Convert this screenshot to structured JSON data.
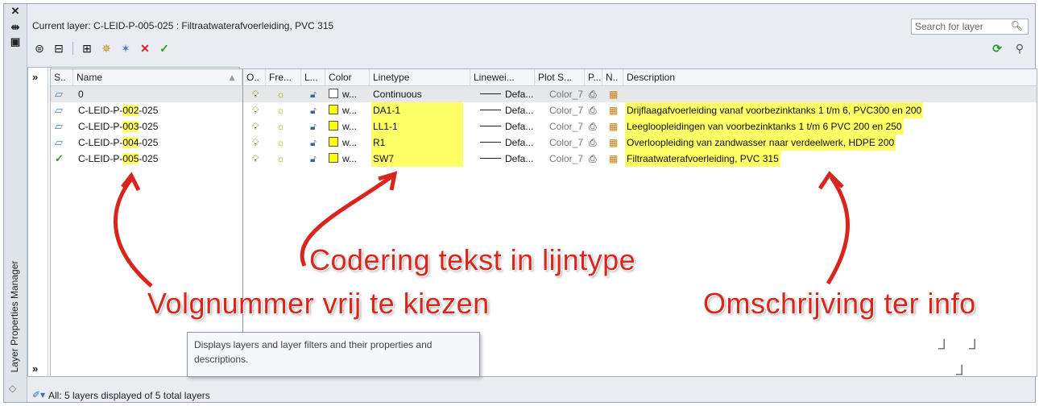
{
  "sidebar": {
    "close_icon": "close-icon",
    "autohide_icon": "autohide-icon",
    "properties_icon": "properties-icon",
    "title": "Layer Properties Manager"
  },
  "header": {
    "current_layer": "Current layer: C-LEID-P-005-025 : Filtraatwaterafvoerleiding, PVC 315",
    "search_placeholder": "Search for layer"
  },
  "toolbar": {
    "icons": [
      "new-property-filter-icon",
      "new-group-filter-icon",
      "layer-states-manager-icon",
      "new-layer-icon",
      "new-layer-vp-frozen-icon",
      "delete-layer-icon",
      "set-current-icon"
    ],
    "right_icons": [
      "refresh-icon",
      "settings-icon"
    ]
  },
  "tree": {
    "expand_label": "»",
    "collapse_label": "»"
  },
  "columns": [
    "S..",
    "Name",
    "O..",
    "Fre...",
    "L...",
    "Color",
    "Linetype",
    "Linewei...",
    "Plot S...",
    "P...",
    "N..",
    "Description"
  ],
  "rows": [
    {
      "status": "layer",
      "name": "0",
      "name_prefix": "0",
      "name_hl": "",
      "name_suffix": "",
      "color": "w...",
      "color_hex": "#ffffff",
      "linetype": "Continuous",
      "lineweight": "Defa...",
      "plotstyle": "Color_7",
      "description": ""
    },
    {
      "status": "layer",
      "name_prefix": "C-LEID-P-",
      "name_hl": "002",
      "name_suffix": "-025",
      "color": "w...",
      "color_hex": "#ffff00",
      "linetype": "DA1-1",
      "lineweight": "Defa...",
      "plotstyle": "Color_7",
      "description": "Drijflaagafvoerleiding vanaf voorbezinktanks 1 t/m 6, PVC300 en 200"
    },
    {
      "status": "layer",
      "name_prefix": "C-LEID-P-",
      "name_hl": "003",
      "name_suffix": "-025",
      "color": "w...",
      "color_hex": "#ffff00",
      "linetype": "LL1-1",
      "lineweight": "Defa...",
      "plotstyle": "Color_7",
      "description": "Leegloopleidingen van voorbezinktanks 1 t/m 6 PVC 200 en 250"
    },
    {
      "status": "layer",
      "name_prefix": "C-LEID-P-",
      "name_hl": "004",
      "name_suffix": "-025",
      "color": "w...",
      "color_hex": "#ffff00",
      "linetype": "R1",
      "lineweight": "Defa...",
      "plotstyle": "Color_7",
      "description": "Overloopleiding van zandwasser naar verdeelwerk, HDPE 200"
    },
    {
      "status": "current",
      "name_prefix": "C-LEID-P-",
      "name_hl": "005",
      "name_suffix": "-025",
      "color": "w...",
      "color_hex": "#ffff00",
      "linetype": "SW7",
      "lineweight": "Defa...",
      "plotstyle": "Color_7",
      "description": "Filtraatwaterafvoerleiding, PVC 315"
    }
  ],
  "annotations": {
    "volgnummer": "Volgnummer vrij te kiezen",
    "codering": "Codering tekst in lijntype",
    "omschrijving": "Omschrijving ter info"
  },
  "tooltip": "Displays layers and layer filters and their properties and descriptions.",
  "footer": {
    "status": "All: 5 layers displayed of 5 total layers"
  },
  "colors": {
    "highlight": "#ffff66",
    "annotation": "#d9261c"
  }
}
